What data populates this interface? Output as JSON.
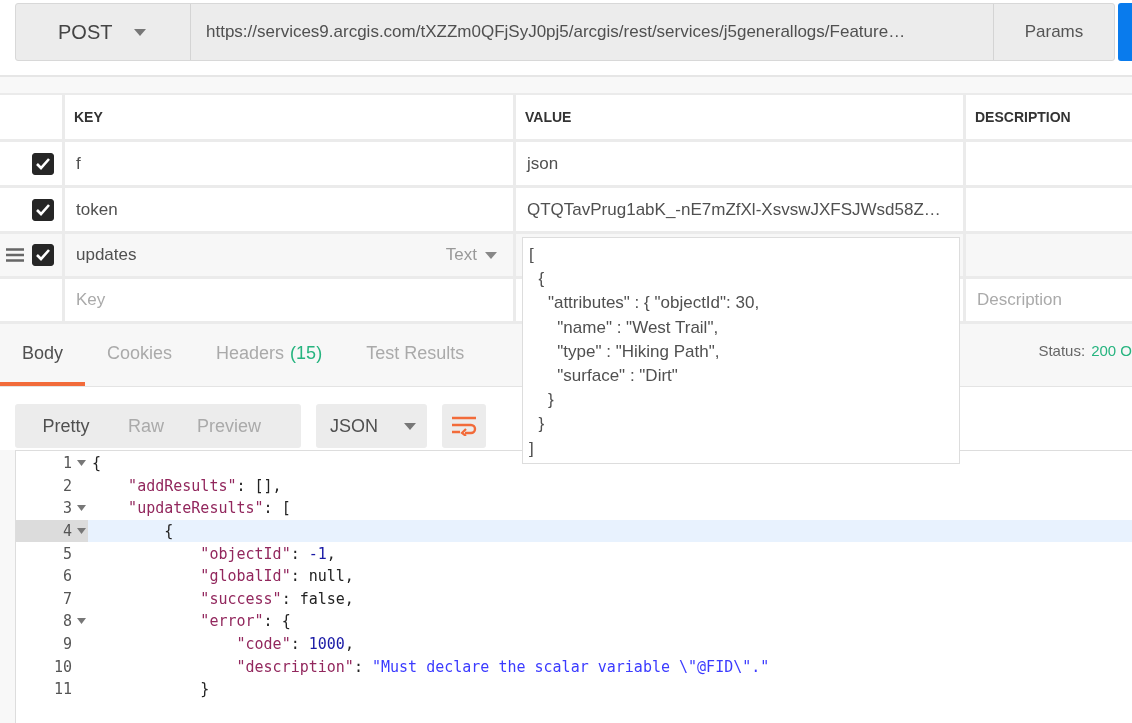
{
  "request": {
    "method": "POST",
    "url": "https://services9.arcgis.com/tXZZm0QFjSyJ0pj5/arcgis/rest/services/j5generallogs/Feature…",
    "params_button": "Params"
  },
  "params_table": {
    "columns": [
      "KEY",
      "VALUE",
      "DESCRIPTION"
    ],
    "rows": [
      {
        "checked": true,
        "key": "f",
        "value": "json",
        "hovered": false
      },
      {
        "checked": true,
        "key": "token",
        "value": "QTQTavPrug1abK_-nE7mZfXl-XsvswJXFSJWsd58Z…",
        "hovered": false
      },
      {
        "checked": true,
        "key": "updates",
        "type": "Text",
        "hovered": true,
        "editor_lines": [
          "[",
          "  {",
          "    \"attributes\" : { \"objectId\": 30,",
          "      \"name\" : \"West Trail\",",
          "      \"type\" : \"Hiking Path\",",
          "      \"surface\" : \"Dirt\"",
          "    }",
          "  }",
          "]"
        ]
      }
    ],
    "new_row": {
      "key_placeholder": "Key",
      "description_placeholder": "Description"
    }
  },
  "response_tabs": [
    {
      "label": "Body",
      "selected": true
    },
    {
      "label": "Cookies",
      "selected": false
    },
    {
      "label": "Headers",
      "count": "(15)",
      "selected": false
    },
    {
      "label": "Test Results",
      "selected": false
    }
  ],
  "status": {
    "label": "Status:",
    "value": "200 O"
  },
  "view_modes": [
    {
      "label": "Pretty",
      "selected": true
    },
    {
      "label": "Raw",
      "selected": false
    },
    {
      "label": "Preview",
      "selected": false
    }
  ],
  "format": "JSON",
  "code_lines": [
    {
      "number": "1",
      "fold": true,
      "selected": false,
      "tokens": [
        {
          "kind": "punct",
          "text": "{"
        }
      ]
    },
    {
      "number": "2",
      "fold": false,
      "selected": false,
      "tokens": [
        {
          "kind": "key",
          "text": "    \"addResults\""
        },
        {
          "kind": "punct",
          "text": ": [],"
        }
      ]
    },
    {
      "number": "3",
      "fold": true,
      "selected": false,
      "tokens": [
        {
          "kind": "key",
          "text": "    \"updateResults\""
        },
        {
          "kind": "punct",
          "text": ": ["
        }
      ]
    },
    {
      "number": "4",
      "fold": true,
      "selected": true,
      "tokens": [
        {
          "kind": "punct",
          "text": "        {"
        }
      ]
    },
    {
      "number": "5",
      "fold": false,
      "selected": false,
      "tokens": [
        {
          "kind": "key",
          "text": "            \"objectId\""
        },
        {
          "kind": "punct",
          "text": ": "
        },
        {
          "kind": "number",
          "text": "-1"
        },
        {
          "kind": "punct",
          "text": ","
        }
      ]
    },
    {
      "number": "6",
      "fold": false,
      "selected": false,
      "tokens": [
        {
          "kind": "key",
          "text": "            \"globalId\""
        },
        {
          "kind": "punct",
          "text": ": null,"
        }
      ]
    },
    {
      "number": "7",
      "fold": false,
      "selected": false,
      "tokens": [
        {
          "kind": "key",
          "text": "            \"success\""
        },
        {
          "kind": "punct",
          "text": ": false,"
        }
      ]
    },
    {
      "number": "8",
      "fold": true,
      "selected": false,
      "tokens": [
        {
          "kind": "key",
          "text": "            \"error\""
        },
        {
          "kind": "punct",
          "text": ": {"
        }
      ]
    },
    {
      "number": "9",
      "fold": false,
      "selected": false,
      "tokens": [
        {
          "kind": "key",
          "text": "                \"code\""
        },
        {
          "kind": "punct",
          "text": ": "
        },
        {
          "kind": "number",
          "text": "1000"
        },
        {
          "kind": "punct",
          "text": ","
        }
      ]
    },
    {
      "number": "10",
      "fold": false,
      "selected": false,
      "tokens": [
        {
          "kind": "key",
          "text": "                \"description\""
        },
        {
          "kind": "punct",
          "text": ": "
        },
        {
          "kind": "string",
          "text": "\"Must declare the scalar variable \\\"@FID\\\".\""
        }
      ]
    },
    {
      "number": "11",
      "fold": false,
      "selected": false,
      "tokens": [
        {
          "kind": "punct",
          "text": "            }"
        }
      ]
    }
  ]
}
